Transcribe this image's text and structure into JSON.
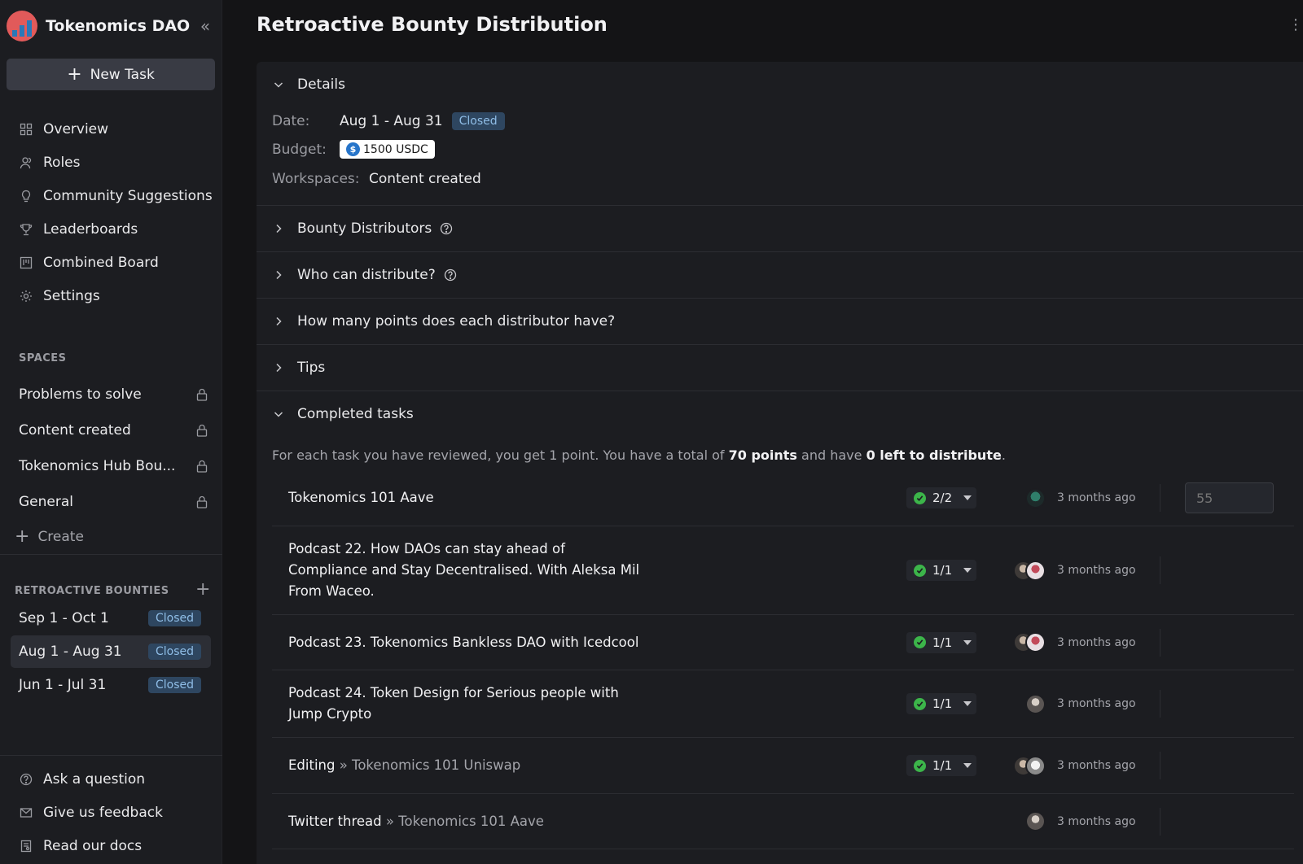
{
  "org": {
    "name": "Tokenomics DAO"
  },
  "new_task_label": "New Task",
  "nav": [
    {
      "label": "Overview",
      "icon": "grid-icon"
    },
    {
      "label": "Roles",
      "icon": "users-icon"
    },
    {
      "label": "Community Suggestions",
      "icon": "lightbulb-icon"
    },
    {
      "label": "Leaderboards",
      "icon": "trophy-icon"
    },
    {
      "label": "Combined Board",
      "icon": "board-icon"
    },
    {
      "label": "Settings",
      "icon": "gear-icon"
    }
  ],
  "spaces_label": "SPACES",
  "spaces": [
    {
      "label": "Problems to solve"
    },
    {
      "label": "Content created"
    },
    {
      "label": "Tokenomics Hub Bou..."
    },
    {
      "label": "General"
    }
  ],
  "create_label": "Create",
  "retro_label": "RETROACTIVE BOUNTIES",
  "retro_items": [
    {
      "label": "Sep 1 - Oct 1",
      "status": "Closed"
    },
    {
      "label": "Aug 1 - Aug 31",
      "status": "Closed"
    },
    {
      "label": "Jun 1 - Jul 31",
      "status": "Closed"
    }
  ],
  "bottom_links": [
    {
      "label": "Ask a question",
      "icon": "help-circle-icon"
    },
    {
      "label": "Give us feedback",
      "icon": "mail-icon"
    },
    {
      "label": "Read our docs",
      "icon": "docs-icon"
    }
  ],
  "page_title": "Retroactive Bounty Distribution",
  "details": {
    "heading": "Details",
    "date_key": "Date:",
    "date_value": "Aug 1 - Aug 31",
    "date_status": "Closed",
    "budget_key": "Budget:",
    "budget_value": "1500 USDC",
    "budget_symbol": "$",
    "workspaces_key": "Workspaces:",
    "workspaces_value": "Content created"
  },
  "sections": {
    "distributors": "Bounty Distributors",
    "who": "Who can distribute?",
    "points": "How many points does each distributor have?",
    "tips": "Tips",
    "completed": "Completed tasks"
  },
  "points_note": {
    "pre": "For each task you have reviewed, you get 1 point. You have a total of ",
    "total": "70 points",
    "mid": " and have ",
    "left": "0 left to distribute",
    "post": "."
  },
  "tasks": [
    {
      "title": "Tokenomics 101 Aave",
      "parent": "",
      "count": "2/2",
      "time": "3 months ago",
      "points_placeholder": "55"
    },
    {
      "title": "Podcast 22. How DAOs can stay ahead of Compliance and Stay Decentralised. With Aleksa Mil From Waceo.",
      "parent": "",
      "count": "1/1",
      "time": "3 months ago"
    },
    {
      "title": "Podcast 23. Tokenomics Bankless DAO with Icedcool",
      "parent": "",
      "count": "1/1",
      "time": "3 months ago"
    },
    {
      "title": "Podcast 24. Token Design for Serious people with Jump Crypto",
      "parent": "",
      "count": "1/1",
      "time": "3 months ago"
    },
    {
      "title": "Editing",
      "parent": "» Tokenomics 101 Uniswap",
      "count": "1/1",
      "time": "3 months ago"
    },
    {
      "title": "Twitter thread",
      "parent": "» Tokenomics 101 Aave",
      "count": "",
      "time": "3 months ago"
    }
  ],
  "colors": {
    "accent_closed_bg": "#2e4660",
    "accent_closed_text": "#8fbde6",
    "success": "#3cb54a",
    "usdc": "#2775ca"
  }
}
